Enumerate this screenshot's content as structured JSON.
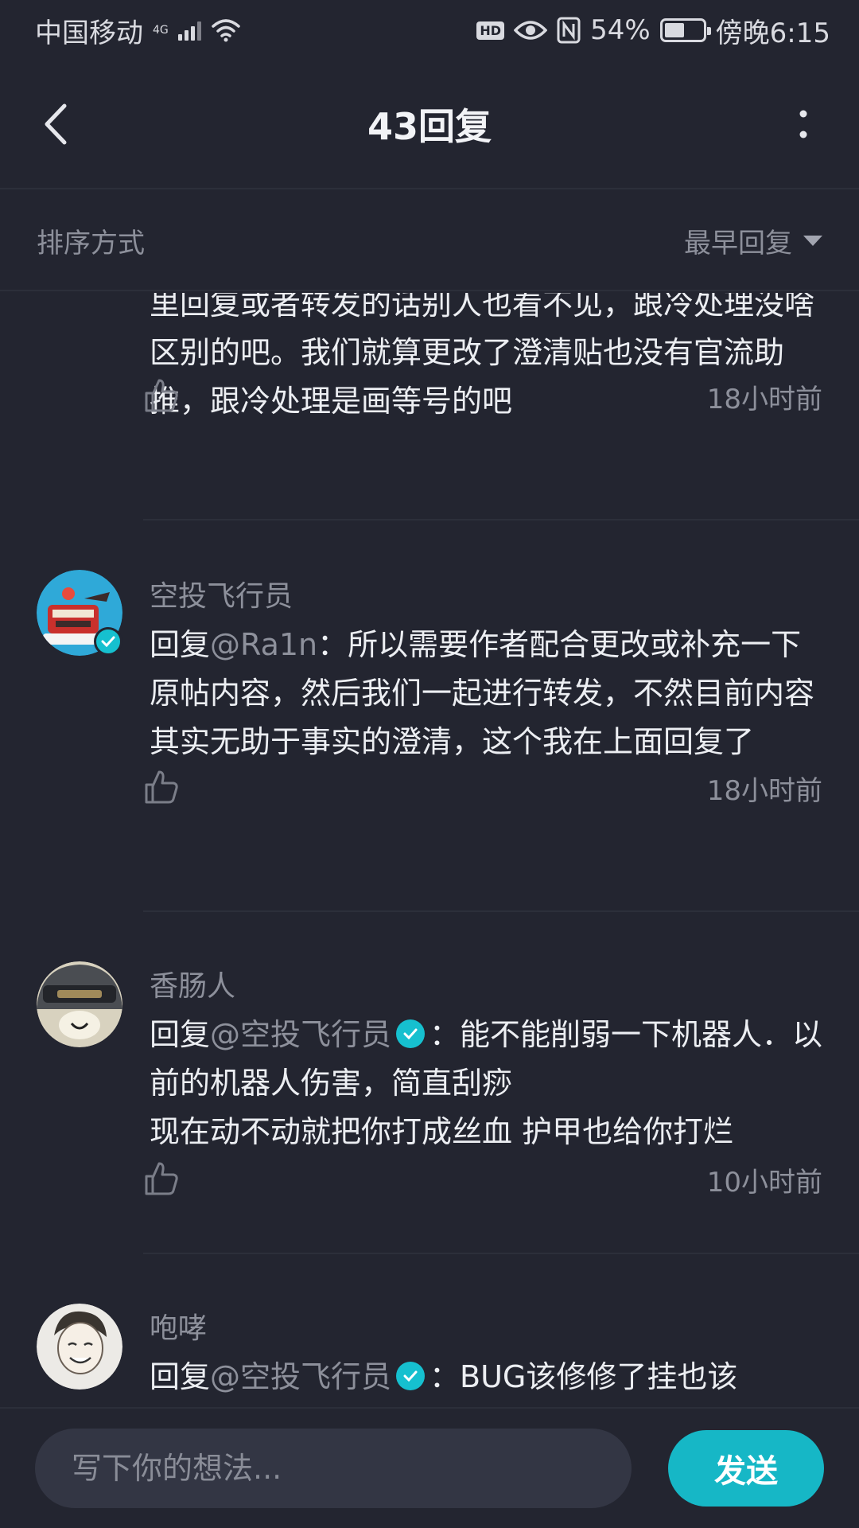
{
  "status_bar": {
    "carrier": "中国移动",
    "network": "4G",
    "battery": "54%",
    "battery_level": 0.54,
    "time": "傍晚6:15",
    "hd": "HD"
  },
  "header": {
    "title": "43回复"
  },
  "sort": {
    "label": "排序方式",
    "selected": "最早回复"
  },
  "comments": [
    {
      "name": "",
      "text": "里回复或者转发的话别人也看不见，跟冷处理没啥区别的吧。我们就算更改了澄清贴也没有官流助推，跟冷处理是画等号的吧",
      "time": "18小时前"
    },
    {
      "name": "空投飞行员",
      "reply_prefix": "回复",
      "mention": "@Ra1n",
      "text": "：所以需要作者配合更改或补充一下原帖内容，然后我们一起进行转发，不然目前内容其实无助于事实的澄清，这个我在上面回复了",
      "time": "18小时前"
    },
    {
      "name": "香肠人",
      "reply_prefix": "回复",
      "mention": "@空投飞行员",
      "text": "：能不能削弱一下机器人．以前的机器人伤害，简直刮痧\n现在动不动就把你打成丝血 护甲也给你打烂",
      "time": "10小时前"
    },
    {
      "name": "咆哮",
      "reply_prefix": "回复",
      "mention": "@空投飞行员",
      "text": "：BUG该修修了挂也该"
    }
  ],
  "composer": {
    "placeholder": "写下你的想法...",
    "send_label": "发送"
  },
  "colors": {
    "background": "#232530",
    "accent": "#16b7c6",
    "muted_text": "#8d909b"
  },
  "icons": [
    "back-icon",
    "more-icon",
    "like-icon",
    "verified-icon",
    "wifi-icon",
    "eye-icon",
    "nfc-icon",
    "battery-icon",
    "caret-down-icon"
  ]
}
